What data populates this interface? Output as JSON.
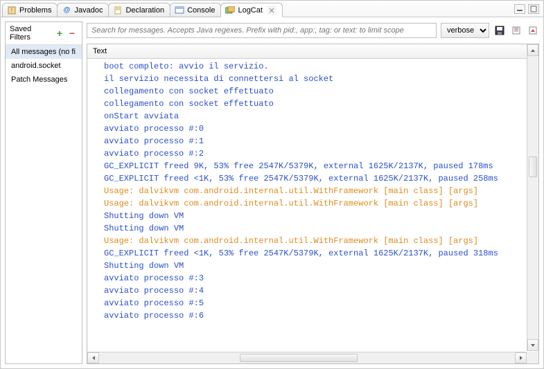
{
  "tabs": [
    {
      "label": "Problems",
      "icon": "⚠"
    },
    {
      "label": "Javadoc",
      "icon": "@"
    },
    {
      "label": "Declaration",
      "icon": "📄"
    },
    {
      "label": "Console",
      "icon": "▭"
    },
    {
      "label": "LogCat",
      "icon": "≣",
      "active": true
    }
  ],
  "sidebar": {
    "title": "Saved Filters",
    "items": [
      {
        "label": "All messages (no fi",
        "selected": true
      },
      {
        "label": "android.socket"
      },
      {
        "label": "Patch Messages"
      }
    ]
  },
  "toolbar": {
    "search_placeholder": "Search for messages. Accepts Java regexes. Prefix with pid:, app:, tag: or text: to limit scope",
    "level": "verbose"
  },
  "log": {
    "column": "Text",
    "lines": [
      {
        "text": "boot completo: avvio il servizio.",
        "color": "blue"
      },
      {
        "text": "il servizio necessita di connettersi al socket",
        "color": "blue"
      },
      {
        "text": "collegamento con socket effettuato",
        "color": "blue"
      },
      {
        "text": "collegamento con socket effettuato",
        "color": "blue"
      },
      {
        "text": "onStart avviata",
        "color": "blue"
      },
      {
        "text": "avviato processo #:0",
        "color": "blue"
      },
      {
        "text": "avviato processo #:1",
        "color": "blue"
      },
      {
        "text": "avviato processo #:2",
        "color": "blue"
      },
      {
        "text": "GC_EXPLICIT freed 9K, 53% free 2547K/5379K, external 1625K/2137K, paused 178ms",
        "color": "blue"
      },
      {
        "text": "GC_EXPLICIT freed <1K, 53% free 2547K/5379K, external 1625K/2137K, paused 258ms",
        "color": "blue"
      },
      {
        "text": "Usage: dalvikvm com.android.internal.util.WithFramework [main class] [args]",
        "color": "orange"
      },
      {
        "text": "Usage: dalvikvm com.android.internal.util.WithFramework [main class] [args]",
        "color": "orange"
      },
      {
        "text": "Shutting down VM",
        "color": "blue"
      },
      {
        "text": "Shutting down VM",
        "color": "blue"
      },
      {
        "text": "Usage: dalvikvm com.android.internal.util.WithFramework [main class] [args]",
        "color": "orange"
      },
      {
        "text": "GC_EXPLICIT freed <1K, 53% free 2547K/5379K, external 1625K/2137K, paused 318ms",
        "color": "blue"
      },
      {
        "text": "Shutting down VM",
        "color": "blue"
      },
      {
        "text": "avviato processo #:3",
        "color": "blue"
      },
      {
        "text": "avviato processo #:4",
        "color": "blue"
      },
      {
        "text": "avviato processo #:5",
        "color": "blue"
      },
      {
        "text": "avviato processo #:6",
        "color": "blue"
      }
    ]
  }
}
